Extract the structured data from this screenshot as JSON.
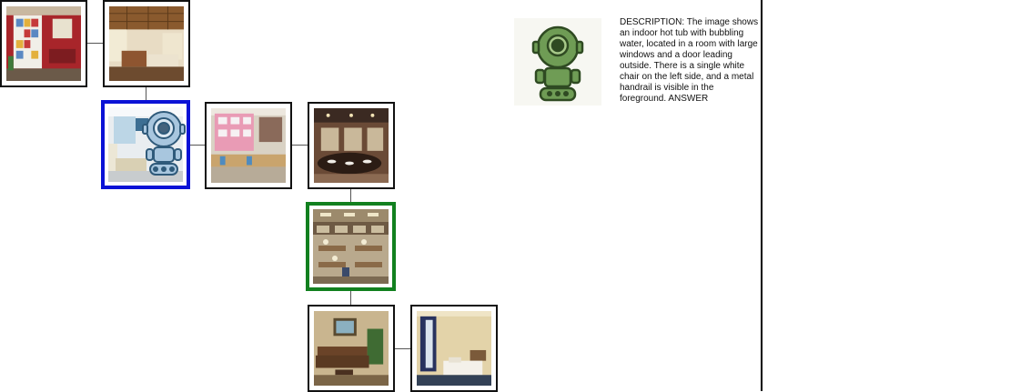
{
  "map": {
    "nodes": [
      {
        "id": "bedroom-red-shelves",
        "scene": "red room with white shelves"
      },
      {
        "id": "living-room-wood-ceiling",
        "scene": "living room with wood ceiling"
      },
      {
        "id": "bright-sitting-room",
        "scene": "bright sitting room",
        "state": "current"
      },
      {
        "id": "classroom-poster",
        "scene": "classroom with poster board"
      },
      {
        "id": "bathroom-counter",
        "scene": "bathroom vanity counter"
      },
      {
        "id": "library-hall",
        "scene": "library hall with tables",
        "state": "goal"
      },
      {
        "id": "lounge-sofa",
        "scene": "lounge with sofa and painting"
      },
      {
        "id": "hotel-bedroom",
        "scene": "hotel bedroom with twin beds"
      }
    ],
    "colors": {
      "current_border": "#0a12d6",
      "goal_border": "#12801f",
      "edge": "#555555"
    }
  },
  "agent": {
    "icon": "robot-icon",
    "color": "#5e8f4a"
  },
  "description": {
    "text": "DESCRIPTION: The image shows an indoor hot tub with bubbling water, located in a room with large windows and a door leading outside. There is a single white chair on the left side, and a metal handrail is visible in the foreground.  ANSWER"
  }
}
